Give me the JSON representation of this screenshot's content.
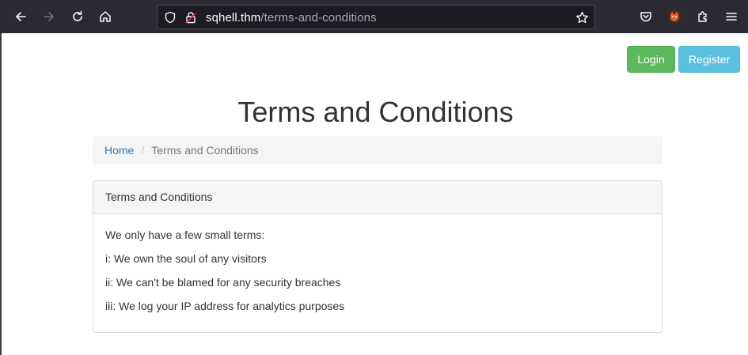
{
  "browser": {
    "url_host": "sqhell.thm",
    "url_path": "/terms-and-conditions",
    "icons": [
      "back-icon",
      "forward-icon",
      "reload-icon",
      "home-icon",
      "shield-icon",
      "lock-icon",
      "bookmark-star-icon",
      "pocket-icon",
      "extension-fox-icon",
      "extensions-icon",
      "menu-icon"
    ]
  },
  "header": {
    "login_label": "Login",
    "register_label": "Register"
  },
  "page": {
    "title": "Terms and Conditions"
  },
  "breadcrumb": {
    "home": "Home",
    "separator": "/",
    "current": "Terms and Conditions"
  },
  "panel": {
    "heading": "Terms and Conditions",
    "lines": [
      "We only have a few small terms:",
      "i: We own the soul of any visitors",
      "ii: We can't be blamed for any security breaches",
      "iii: We log your IP address for analytics purposes"
    ]
  },
  "colors": {
    "login": "#5cb85c",
    "register": "#5bc0de",
    "link": "#337ab7",
    "toolbar": "#2b2a33"
  }
}
